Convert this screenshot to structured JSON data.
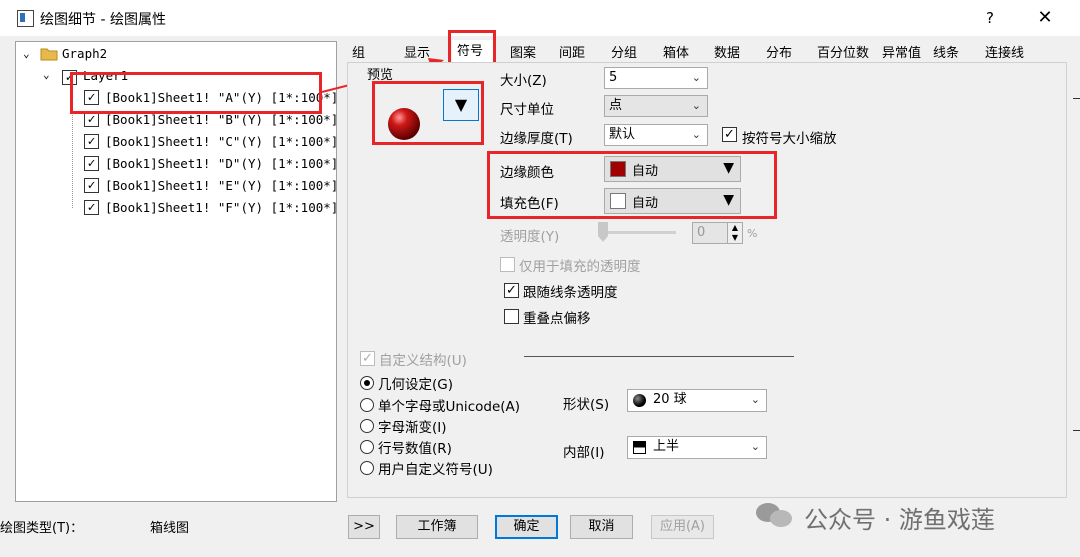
{
  "window": {
    "title": "绘图细节 - 绘图属性",
    "help": "?",
    "close": "✕"
  },
  "tree": {
    "root": "Graph2",
    "layer": "Layer1",
    "items": [
      "[Book1]Sheet1! \"A\"(Y) [1*:100*]",
      "[Book1]Sheet1! \"B\"(Y) [1*:100*]",
      "[Book1]Sheet1! \"C\"(Y) [1*:100*]",
      "[Book1]Sheet1! \"D\"(Y) [1*:100*]",
      "[Book1]Sheet1! \"E\"(Y) [1*:100*]",
      "[Book1]Sheet1! \"F\"(Y) [1*:100*]"
    ]
  },
  "tabs": [
    "组",
    "显示",
    "符号",
    "图案",
    "间距",
    "箱体",
    "数据",
    "分布",
    "百分位数",
    "异常值",
    "线条",
    "连接线"
  ],
  "tab_groupview": "分组",
  "active_tab": "符号",
  "preview_label": "预览",
  "symbol": {
    "size_label": "大小(Z)",
    "size_value": "5",
    "unit_label": "尺寸单位",
    "unit_value": "点",
    "edge_label": "边缘厚度(T)",
    "edge_value": "默认",
    "scale_label": "按符号大小缩放",
    "edge_color_label": "边缘颜色",
    "edge_color_value": "自动",
    "edge_color": "#a00000",
    "fill_color_label": "填充色(F)",
    "fill_color_value": "自动",
    "fill_color": "#ffffff",
    "transparency_label": "透明度(Y)",
    "transparency_value": "0",
    "transparency_unit": "%",
    "fill_only_label": "仅用于填充的透明度",
    "follow_line_label": "跟随线条透明度",
    "overlap_label": "重叠点偏移"
  },
  "construct": {
    "custom_label": "自定义结构(U)",
    "options": [
      "几何设定(G)",
      "单个字母或Unicode(A)",
      "字母渐变(I)",
      "行号数值(R)",
      "用户自定义符号(U)"
    ],
    "shape_label": "形状(S)",
    "shape_value": "20 球",
    "interior_label": "内部(I)",
    "interior_value": "上半"
  },
  "footer": {
    "plot_type_label": "绘图类型(T)：",
    "plot_type_value": "箱线图",
    "expand": ">>",
    "workbook": "工作簿",
    "ok": "确定",
    "cancel": "取消",
    "apply": "应用(A)"
  },
  "watermark": "公众号 · 游鱼戏莲",
  "colors": {
    "highlight": "#e8262a",
    "accent": "#0078d7"
  }
}
